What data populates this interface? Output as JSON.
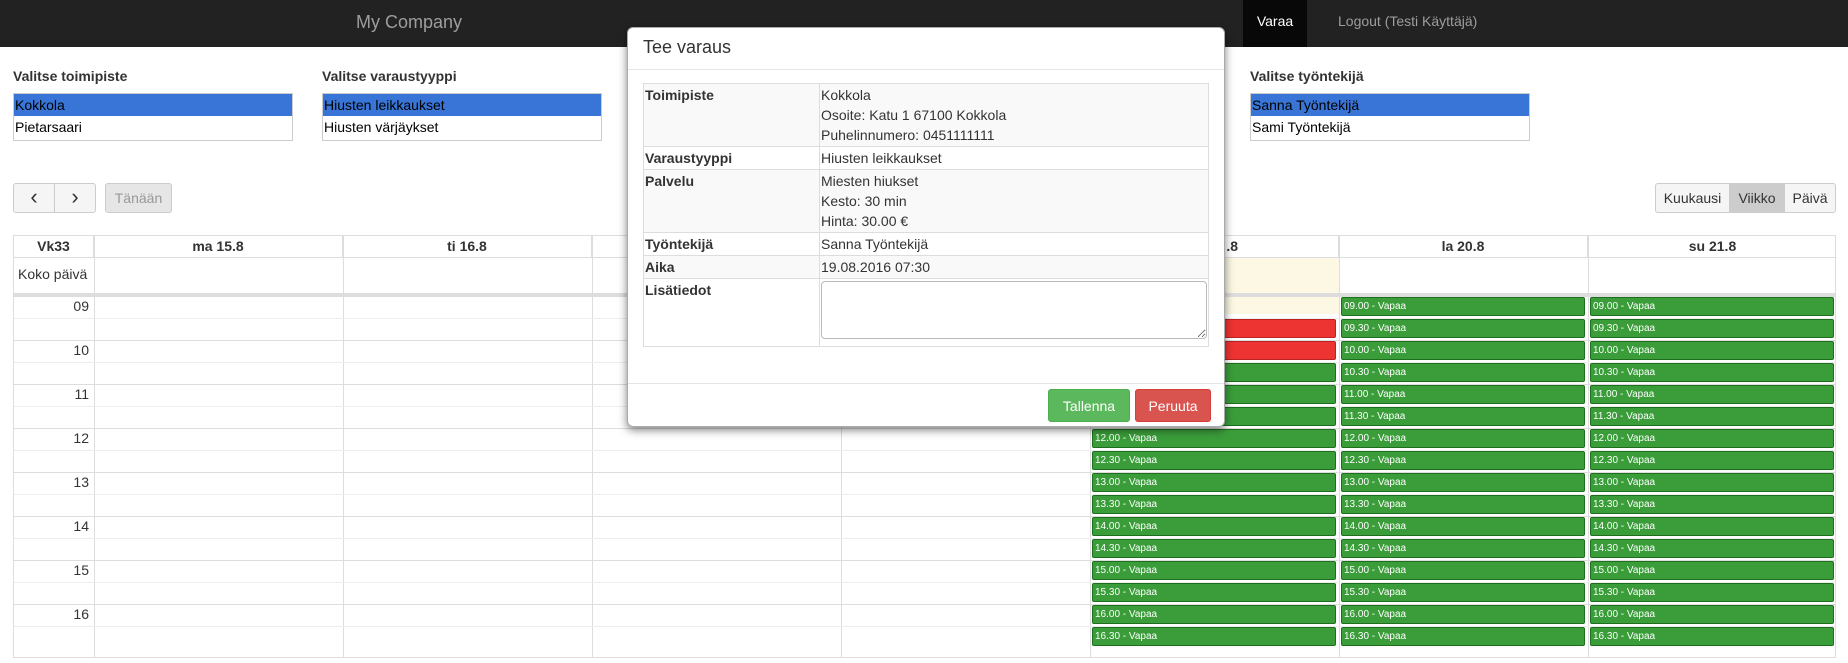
{
  "nav": {
    "brand": "My Company",
    "varaa": "Varaa",
    "logout": "Logout (Testi Käyttäjä)"
  },
  "selectors": {
    "toimipiste": {
      "label": "Valitse toimipiste",
      "options": [
        "Kokkola",
        "Pietarsaari"
      ],
      "selected": "Kokkola"
    },
    "varaustyyppi": {
      "label": "Valitse varaustyyppi",
      "options": [
        "Hiusten leikkaukset",
        "Hiusten värjäykset"
      ],
      "selected": "Hiusten leikkaukset"
    },
    "tyontekija": {
      "label": "Valitse työntekijä",
      "options": [
        "Sanna Työntekijä",
        "Sami Työntekijä"
      ],
      "selected": "Sanna Työntekijä"
    }
  },
  "toolbar": {
    "prev": "‹",
    "next": "›",
    "today": "Tänään",
    "views": [
      "Kuukausi",
      "Viikko",
      "Päivä"
    ],
    "active_view": "Viikko"
  },
  "calendar": {
    "week": "Vk33",
    "allday": "Koko päivä",
    "days": [
      "ma 15.8",
      "ti 16.8",
      "",
      "",
      ".8",
      "la 20.8",
      "su 21.8"
    ],
    "hours": [
      "09",
      "10",
      "11",
      "12",
      "13",
      "14",
      "15",
      "16"
    ],
    "fri_slots": [
      "",
      "",
      "",
      "",
      "",
      "",
      "12.00 - Vapaa",
      "12.30 - Vapaa",
      "13.00 - Vapaa",
      "13.30 - Vapaa",
      "14.00 - Vapaa",
      "14.30 - Vapaa",
      "15.00 - Vapaa",
      "15.30 - Vapaa",
      "16.00 - Vapaa",
      "16.30 - Vapaa"
    ],
    "weekend_slots": [
      "09.00 - Vapaa",
      "09.30 - Vapaa",
      "10.00 - Vapaa",
      "10.30 - Vapaa",
      "11.00 - Vapaa",
      "11.30 - Vapaa",
      "12.00 - Vapaa",
      "12.30 - Vapaa",
      "13.00 - Vapaa",
      "13.30 - Vapaa",
      "14.00 - Vapaa",
      "14.30 - Vapaa",
      "15.00 - Vapaa",
      "15.30 - Vapaa",
      "16.00 - Vapaa",
      "16.30 - Vapaa"
    ]
  },
  "modal": {
    "title": "Tee varaus",
    "rows": {
      "toimipiste": {
        "label": "Toimipiste",
        "name": "Kokkola",
        "address": "Osoite: Katu 1 67100 Kokkola",
        "phone": "Puhelinnumero: 0451111111"
      },
      "varaustyyppi": {
        "label": "Varaustyyppi",
        "value": "Hiusten leikkaukset"
      },
      "palvelu": {
        "label": "Palvelu",
        "name": "Miesten hiukset",
        "duration": "Kesto: 30 min",
        "price": "Hinta: 30.00 €"
      },
      "tyontekija": {
        "label": "Työntekijä",
        "value": "Sanna Työntekijä"
      },
      "aika": {
        "label": "Aika",
        "value": "19.08.2016 07:30"
      },
      "lisatiedot": {
        "label": "Lisätiedot",
        "value": ""
      }
    },
    "save": "Tallenna",
    "cancel": "Peruuta"
  },
  "colors": {
    "navbar": "#222222",
    "selected": "#3875d7",
    "slot_green": "#3a9d3a",
    "slot_red": "#ee3333",
    "save": "#5cb85c",
    "cancel": "#d9534f"
  }
}
